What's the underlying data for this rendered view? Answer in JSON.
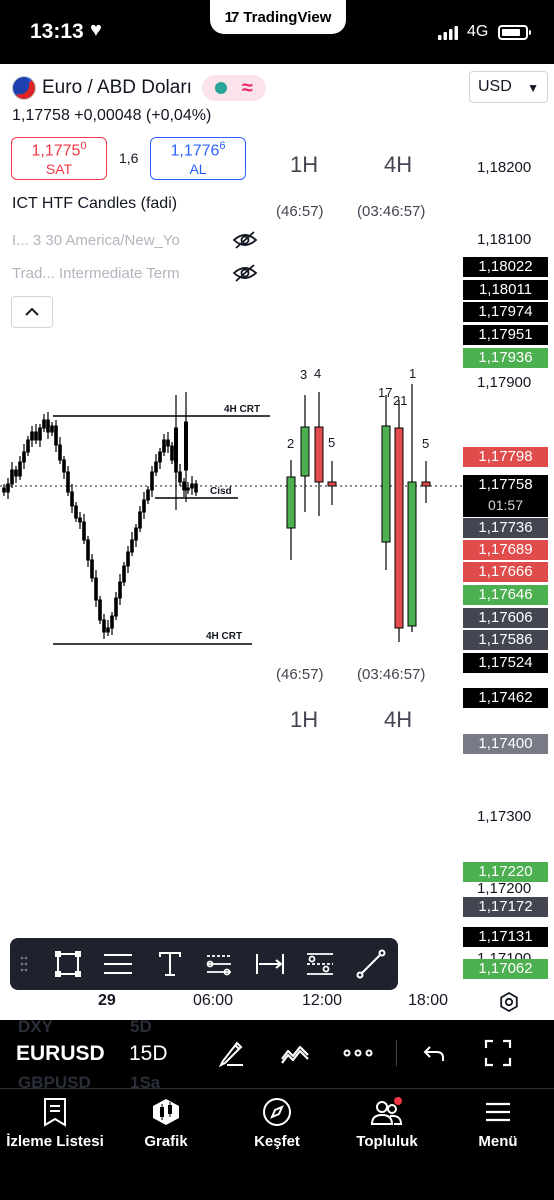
{
  "status_bar": {
    "time": "13:13",
    "network": "4G",
    "app_badge": "TradingView"
  },
  "header": {
    "symbol_name": "Euro / ABD Doları",
    "currency": "USD",
    "price_line": "1,17758 +0,00048 (+0,04%)",
    "sell": {
      "price_main": "1,1775",
      "price_sup": "0",
      "label": "SAT"
    },
    "buy": {
      "price_main": "1,1776",
      "price_sup": "6",
      "label": "AL"
    },
    "spread": "1,6"
  },
  "indicator": {
    "name": "ICT HTF Candles (fadi)",
    "row1": "I...  3 30 America/New_Yo",
    "row2": "Trad...  Intermediate Term"
  },
  "htf": {
    "top_1h": "1H",
    "top_4h": "4H",
    "top_timer_1h": "(46:57)",
    "top_timer_4h": "(03:46:57)",
    "bottom_1h": "1H",
    "bottom_4h": "4H",
    "bottom_timer_1h": "(46:57)",
    "bottom_timer_4h": "(03:46:57)",
    "candle_labels_1h": [
      "2",
      "3",
      "4",
      "5"
    ],
    "candle_labels_4h": [
      "17",
      "21",
      "1",
      "5"
    ]
  },
  "annotations": {
    "crt_top": "4H CRT",
    "crt_bottom": "4H CRT",
    "cisd": "Cisd"
  },
  "price_axis": {
    "labels": [
      "1,18200",
      "1,18100",
      "1,17900",
      "1,17300",
      "1,17200",
      "1,17100"
    ],
    "tags": [
      {
        "value": "1,18022",
        "color": "#000000"
      },
      {
        "value": "1,18011",
        "color": "#000000"
      },
      {
        "value": "1,17974",
        "color": "#000000"
      },
      {
        "value": "1,17951",
        "color": "#000000"
      },
      {
        "value": "1,17936",
        "color": "#4caf50"
      },
      {
        "value": "1,17798",
        "color": "#e04b4b"
      },
      {
        "value": "1,17758",
        "color": "#000000"
      },
      {
        "value": "1,17736",
        "color": "#434651"
      },
      {
        "value": "1,17689",
        "color": "#e04b4b"
      },
      {
        "value": "1,17666",
        "color": "#e04b4b"
      },
      {
        "value": "1,17646",
        "color": "#4caf50"
      },
      {
        "value": "1,17606",
        "color": "#434651"
      },
      {
        "value": "1,17586",
        "color": "#434651"
      },
      {
        "value": "1,17524",
        "color": "#000000"
      },
      {
        "value": "1,17462",
        "color": "#000000"
      },
      {
        "value": "1,17400",
        "color": "#787b86"
      },
      {
        "value": "1,17220",
        "color": "#4caf50"
      },
      {
        "value": "1,17172",
        "color": "#434651"
      },
      {
        "value": "1,17131",
        "color": "#000000"
      },
      {
        "value": "1,17062",
        "color": "#4caf50"
      }
    ],
    "countdown": "01:57"
  },
  "time_axis": {
    "labels": [
      "29",
      "06:00",
      "12:00",
      "18:00"
    ]
  },
  "bottom_toolbar": {
    "symbol": "EURUSD",
    "interval": "15D",
    "ghost_items": [
      "DXY",
      "5D",
      "GBPUSD",
      "1Sa"
    ]
  },
  "nav": {
    "watchlist": "İzleme Listesi",
    "chart": "Grafik",
    "explore": "Keşfet",
    "community": "Topluluk",
    "menu": "Menü"
  },
  "colors": {
    "up": "#4caf50",
    "down": "#e04b4b",
    "sell": "#f23645",
    "buy": "#2962ff"
  }
}
